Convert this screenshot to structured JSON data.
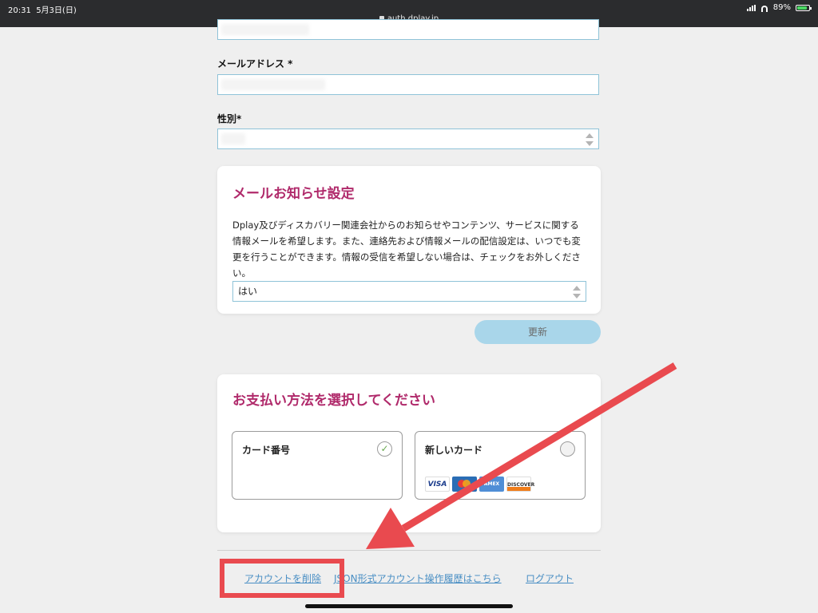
{
  "status_bar": {
    "time": "20:31",
    "date": "5月3日(日)",
    "url": "auth.dplay.jp",
    "battery": "89%",
    "battery_level": 0.89
  },
  "form": {
    "email_label": "メールアドレス *",
    "gender_label": "性別*"
  },
  "mail_settings": {
    "title": "メールお知らせ設定",
    "description": "Dplay及びディスカバリー関連会社からのお知らせやコンテンツ、サービスに関する情報メールを希望します。また、連絡先および情報メールの配信設定は、いつでも変更を行うことができます。情報の受信を希望しない場合は、チェックをお外しください。",
    "select_value": "はい"
  },
  "update_button": "更新",
  "payment": {
    "title": "お支払い方法を選択してください",
    "card_number_label": "カード番号",
    "new_card_label": "新しいカード",
    "card_brands": [
      "VISA",
      "MasterCard",
      "AMEX",
      "DISCOVER"
    ]
  },
  "footer": {
    "delete_account": "アカウントを削除",
    "json_history": "JSON形式アカウント操作履歴はこちら",
    "logout": "ログアウト"
  },
  "colors": {
    "accent": "#b02a6b",
    "link": "#4a8fc4",
    "button": "#a9d6ea",
    "annotation": "#e94a4f"
  }
}
